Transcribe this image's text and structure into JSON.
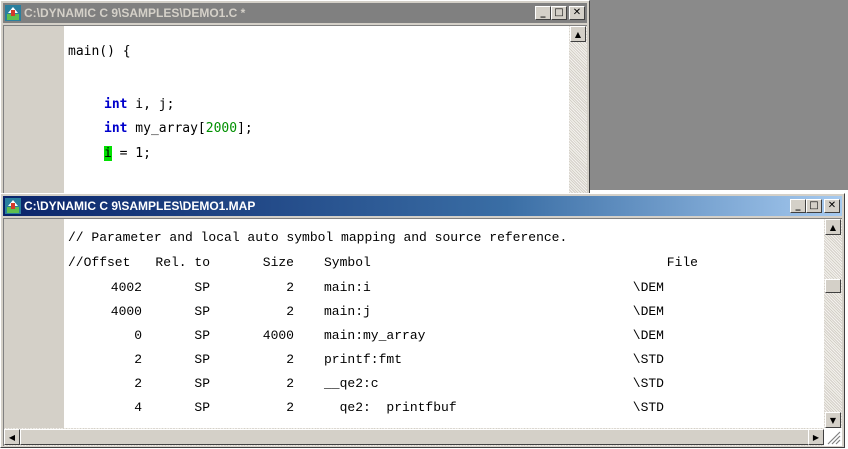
{
  "editor_window": {
    "title": "C:\\DYNAMIC C 9\\SAMPLES\\DEMO1.C *",
    "code": {
      "line1": "main() {",
      "line2_kw": "int",
      "line2_rest": " i, j;",
      "line3_kw": "int",
      "line3_mid": " my_array[",
      "line3_num": "2000",
      "line3_end": "];",
      "line4_cursor": "i",
      "line4_rest": " = 1;"
    }
  },
  "map_window": {
    "title": "C:\\DYNAMIC C 9\\SAMPLES\\DEMO1.MAP",
    "comment_line": "// Parameter and local auto symbol mapping and source reference.",
    "header": {
      "offset": "//Offset",
      "rel": "Rel. to",
      "size": "Size",
      "symbol": "Symbol",
      "file": "File"
    },
    "rows": [
      {
        "offset": "4002",
        "rel": "SP",
        "size": "2",
        "symbol": "main:i",
        "file": "\\DEM"
      },
      {
        "offset": "4000",
        "rel": "SP",
        "size": "2",
        "symbol": "main:j",
        "file": "\\DEM"
      },
      {
        "offset": "0",
        "rel": "SP",
        "size": "4000",
        "symbol": "main:my_array",
        "file": "\\DEM"
      },
      {
        "offset": "2",
        "rel": "SP",
        "size": "2",
        "symbol": "printf:fmt",
        "file": "\\STD"
      },
      {
        "offset": "2",
        "rel": "SP",
        "size": "2",
        "symbol": "__qe2:c",
        "file": "\\STD"
      },
      {
        "offset": "4",
        "rel": "SP",
        "size": "2",
        "symbol": "  qe2:  printfbuf",
        "file": "\\STD"
      }
    ]
  },
  "colors": {
    "keyword": "#0000cc",
    "number": "#009000",
    "cursor_highlight": "#00e000",
    "active_title": "#0a246a",
    "inactive_title": "#808080"
  },
  "icons": {
    "app_icon": "dynamic-c-icon",
    "minimize": "minimize-icon",
    "maximize": "maximize-icon",
    "close": "close-icon"
  }
}
